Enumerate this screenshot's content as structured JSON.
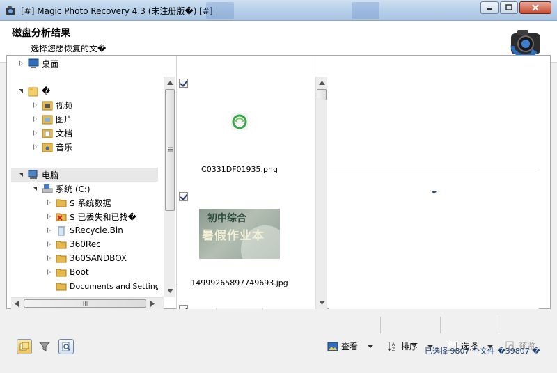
{
  "window": {
    "title": "[#] Magic Photo Recovery 4.3 (未注册版�) [#]"
  },
  "header": {
    "title": "磁盘分析结果",
    "subtitle": "选择您想恢复的文�"
  },
  "tree": {
    "items": [
      {
        "label": "桌面",
        "icon": "desktop-icon"
      },
      {
        "label": "�",
        "icon": "libraries-icon"
      },
      {
        "label": "视频",
        "icon": "videos-folder-icon"
      },
      {
        "label": "图片",
        "icon": "pictures-folder-icon"
      },
      {
        "label": "文档",
        "icon": "documents-folder-icon"
      },
      {
        "label": "音乐",
        "icon": "music-folder-icon"
      },
      {
        "label": "电脑",
        "icon": "computer-icon"
      },
      {
        "label": "系统 (C:)",
        "icon": "drive-icon"
      },
      {
        "label": "$ 系统数据",
        "icon": "folder-icon"
      },
      {
        "label": "$ 已丢失和已找�",
        "icon": "lost-found-folder-icon"
      },
      {
        "label": "$Recycle.Bin",
        "icon": "recycle-bin-icon"
      },
      {
        "label": "360Rec",
        "icon": "folder-icon"
      },
      {
        "label": "360SANDBOX",
        "icon": "folder-icon"
      },
      {
        "label": "Boot",
        "icon": "folder-icon"
      },
      {
        "label": "Documents and Settings",
        "icon": "folder-icon"
      }
    ]
  },
  "files": [
    {
      "name": "C0331DF01935.png",
      "checked": true
    },
    {
      "name": "14999265897749693.jpg",
      "checked": true,
      "thumb_text_top": "初中综合",
      "thumb_text_bottom": "暑假作业本"
    },
    {
      "name": "",
      "checked": true
    }
  ],
  "toolbar": {
    "view_label": "查看",
    "sort_label": "排序",
    "select_label": "选择",
    "preview_label": "预览"
  },
  "status": {
    "text": "已选择 9807 个文件 �39807 �"
  },
  "colors": {
    "accent": "#2a6fc4",
    "folder": "#e7b84a"
  }
}
